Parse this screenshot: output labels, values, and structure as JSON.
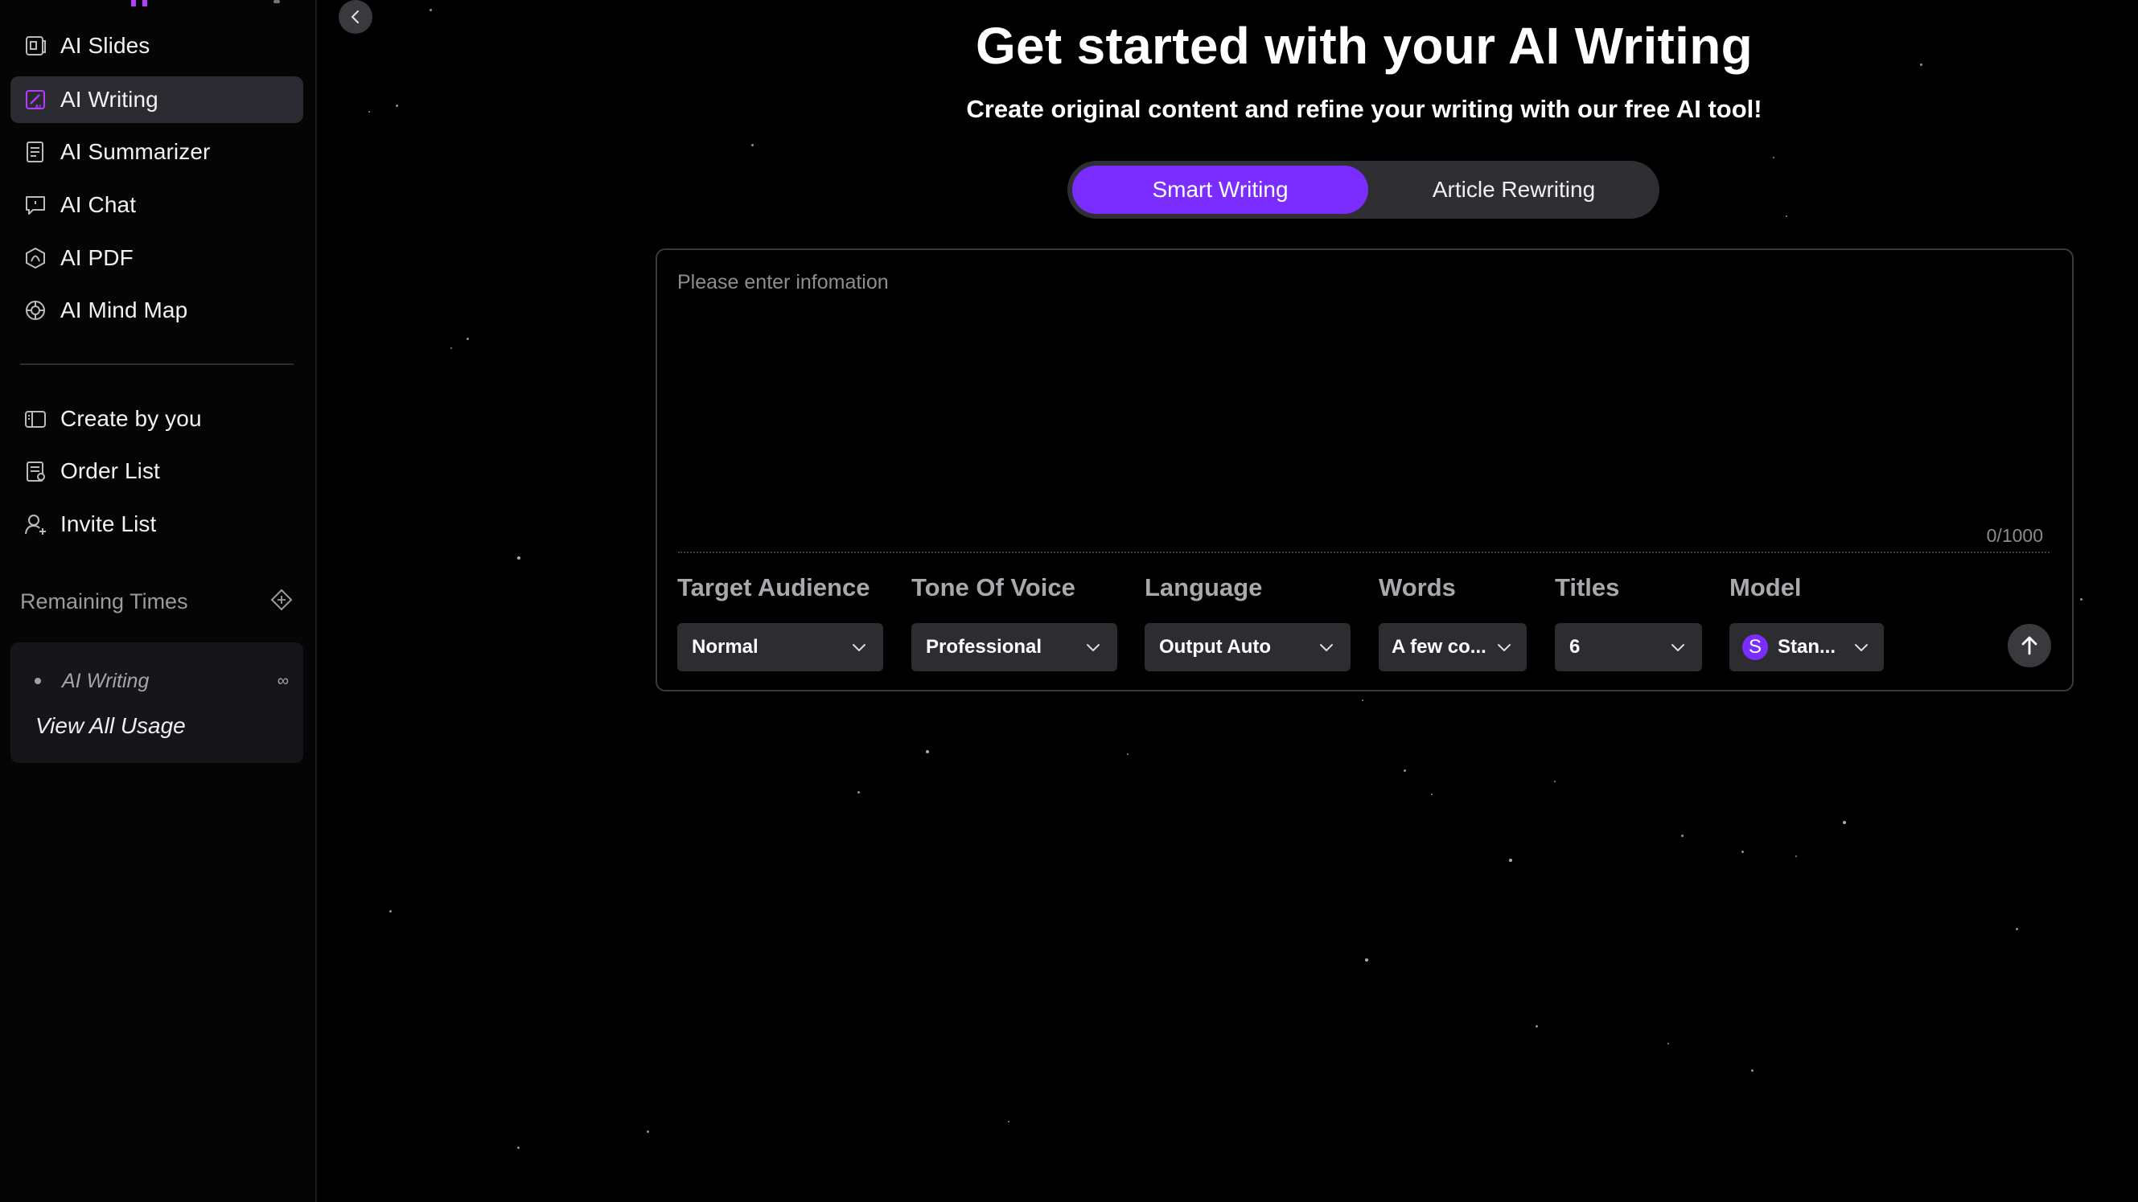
{
  "sidebar": {
    "nav_items": [
      {
        "label": "AI Slides",
        "icon": "slides-icon",
        "active": false
      },
      {
        "label": "AI Writing",
        "icon": "writing-icon",
        "active": true
      },
      {
        "label": "AI Summarizer",
        "icon": "summarizer-icon",
        "active": false
      },
      {
        "label": "AI Chat",
        "icon": "chat-icon",
        "active": false
      },
      {
        "label": "AI PDF",
        "icon": "pdf-icon",
        "active": false
      },
      {
        "label": "AI Mind Map",
        "icon": "mind-map-icon",
        "active": false
      }
    ],
    "secondary_items": [
      {
        "label": "Create by you",
        "icon": "create-icon"
      },
      {
        "label": "Order List",
        "icon": "order-list-icon"
      },
      {
        "label": "Invite List",
        "icon": "invite-icon"
      }
    ],
    "remaining_label": "Remaining Times",
    "usage": {
      "item": "AI Writing",
      "quota": "∞",
      "view_all": "View All Usage"
    }
  },
  "main": {
    "title": "Get started with your AI Writing",
    "subtitle": "Create original content and refine your writing with our free AI tool!",
    "modes": [
      "Smart Writing",
      "Article Rewriting"
    ],
    "active_mode": "Smart Writing",
    "editor": {
      "placeholder": "Please enter infomation",
      "value": "",
      "counter": "0/1000"
    },
    "options": {
      "target_audience": {
        "label": "Target Audience",
        "value": "Normal"
      },
      "tone": {
        "label": "Tone Of Voice",
        "value": "Professional"
      },
      "language": {
        "label": "Language",
        "value": "Output Auto"
      },
      "words": {
        "label": "Words",
        "value": "A few co..."
      },
      "titles": {
        "label": "Titles",
        "value": "6"
      },
      "model": {
        "label": "Model",
        "value": "Stan...",
        "badge": "S"
      }
    }
  },
  "colors": {
    "accent": "#7b2cff",
    "background": "#000000",
    "sidebar_active": "#2b2b31",
    "control_bg": "#2d2d31"
  }
}
